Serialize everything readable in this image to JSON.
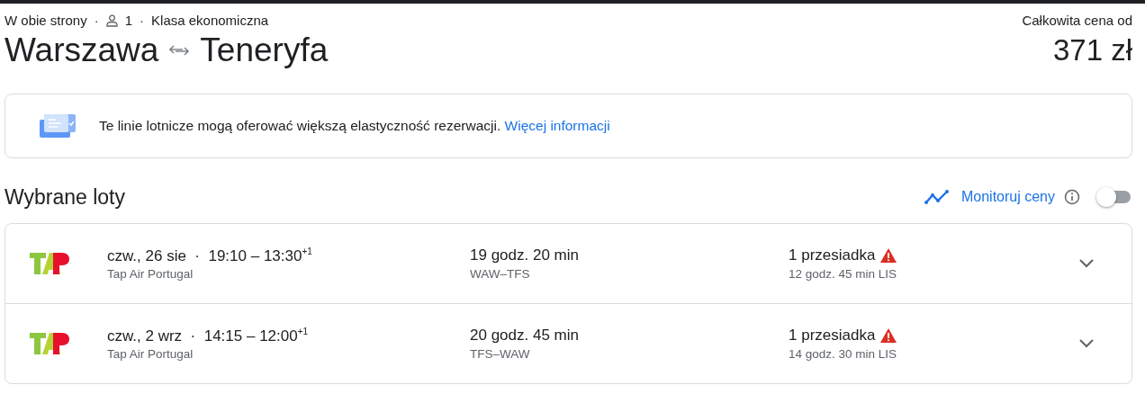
{
  "trip": {
    "type": "W obie strony",
    "separator_1": "·",
    "passengers": "1",
    "separator_2": "·",
    "cabin": "Klasa ekonomiczna"
  },
  "route": {
    "from": "Warszawa",
    "to": "Teneryfa"
  },
  "price": {
    "label": "Całkowita cena od",
    "value": "371 zł"
  },
  "notice": {
    "text": "Te linie lotnicze mogą oferować większą elastyczność rezerwacji.",
    "link": "Więcej informacji"
  },
  "section": {
    "title": "Wybrane loty",
    "track_label": "Monitoruj ceny",
    "track_on": false
  },
  "flights": [
    {
      "date": "czw., 26 sie",
      "separator": "·",
      "times": "19:10 – 13:30$^{+1}$",
      "airline": "Tap Air Portugal",
      "duration": "19 godz. 20 min",
      "route": "WAW–TFS",
      "stops": "1 przesiadka",
      "layover": "12 godz. 45 min LIS",
      "warning": true,
      "expanded": false
    },
    {
      "date": "czw., 2 wrz",
      "separator": "·",
      "times": "14:15 – 12:00$^{+1}$",
      "airline": "Tap Air Portugal",
      "duration": "20 godz. 45 min",
      "route": "TFS–WAW",
      "stops": "1 przesiadka",
      "layover": "14 godz. 30 min LIS",
      "warning": true,
      "expanded": false
    }
  ]
}
